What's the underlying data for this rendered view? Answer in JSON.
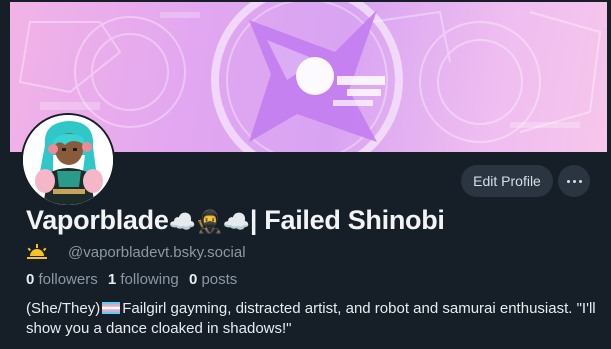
{
  "profile": {
    "display_name_prefix": "Vaporblade",
    "display_name_emojis": "☁️🥷☁️",
    "display_name_suffix": "| Failed Shinobi",
    "handle": "@vaporbladevt.bsky.social",
    "followers_count": "0",
    "followers_label": "followers",
    "following_count": "1",
    "following_label": "following",
    "posts_count": "0",
    "posts_label": "posts",
    "bio_prefix": "(She/They)",
    "bio_text": "Failgirl gayming, distracted artist, and robot and samurai enthusiast. \"I'll show you a dance cloaked in shadows!\""
  },
  "actions": {
    "edit_profile_label": "Edit Profile"
  },
  "colors": {
    "background": "#161e27",
    "button_bg": "#2b3541",
    "text_primary": "#e7ecf0",
    "text_secondary": "#8b98a5",
    "banner_pink": "#f2b3e6",
    "banner_purple": "#d8a4f2",
    "logo_purple": "#c37df0"
  },
  "icons": {
    "banner_logo": "vaporblade-logo",
    "handle_icon": "sunset-icon",
    "more_icon": "ellipsis-icon",
    "bio_flag": "trans-flag-icon"
  }
}
